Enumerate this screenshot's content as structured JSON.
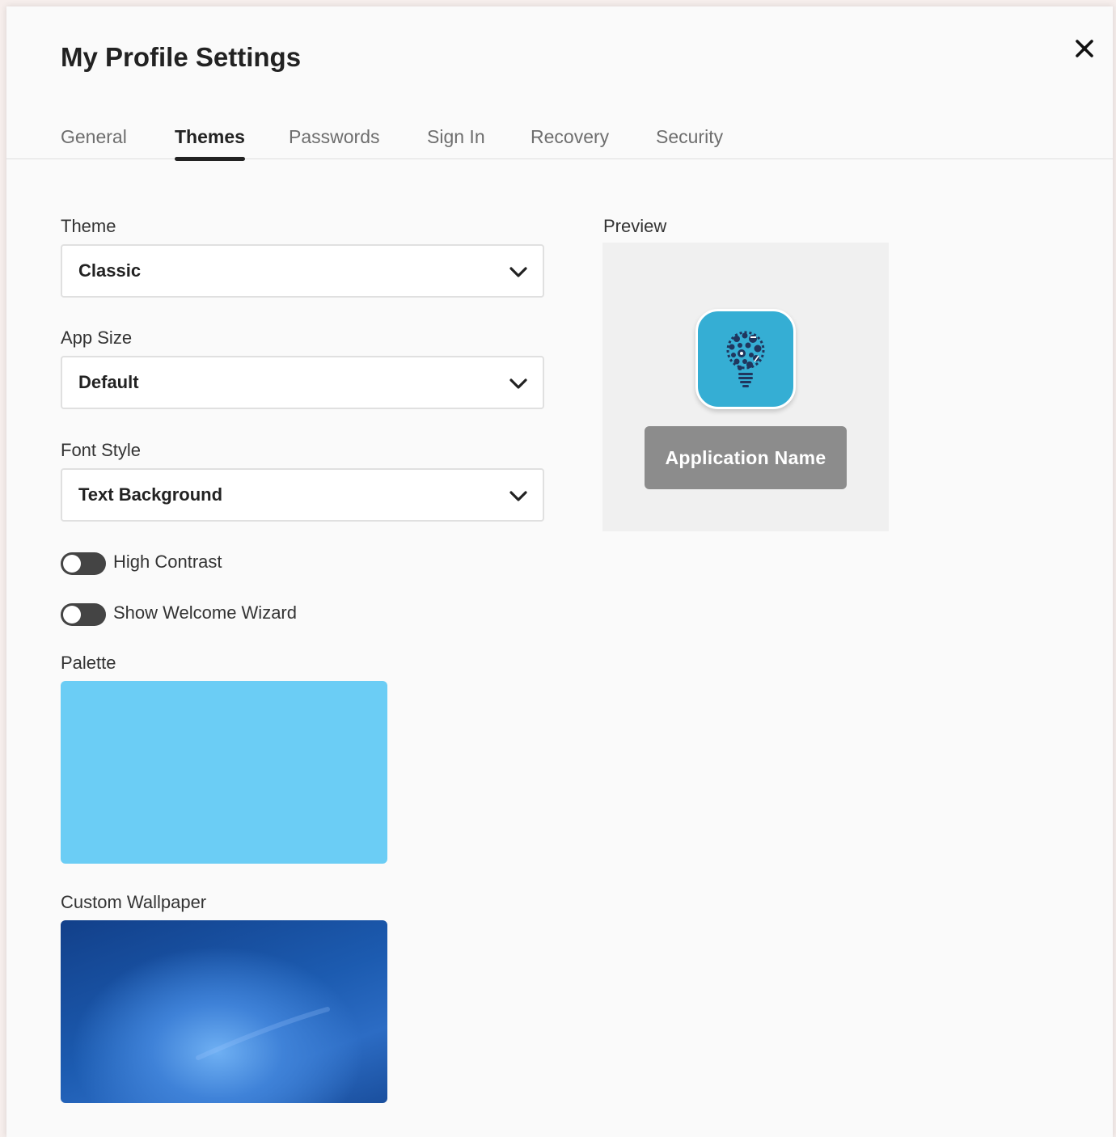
{
  "dialog": {
    "title": "My Profile Settings",
    "close_icon": "close-icon"
  },
  "tabs": [
    {
      "label": "General",
      "active": false
    },
    {
      "label": "Themes",
      "active": true
    },
    {
      "label": "Passwords",
      "active": false
    },
    {
      "label": "Sign In",
      "active": false
    },
    {
      "label": "Recovery",
      "active": false
    },
    {
      "label": "Security",
      "active": false
    }
  ],
  "theme": {
    "label": "Theme",
    "value": "Classic"
  },
  "app_size": {
    "label": "App Size",
    "value": "Default"
  },
  "font_style": {
    "label": "Font Style",
    "value": "Text Background"
  },
  "toggles": {
    "high_contrast": {
      "label": "High Contrast",
      "on": false
    },
    "welcome_wizard": {
      "label": "Show Welcome Wizard",
      "on": false
    }
  },
  "palette": {
    "label": "Palette",
    "color": "#6bcdf5"
  },
  "wallpaper": {
    "label": "Custom Wallpaper"
  },
  "preview": {
    "label": "Preview",
    "app_name": "Application Name",
    "icon": "lightbulb-icon",
    "icon_color": "#35aed4"
  },
  "colors": {
    "accent": "#222222",
    "tab_inactive": "#6e6e6e"
  }
}
